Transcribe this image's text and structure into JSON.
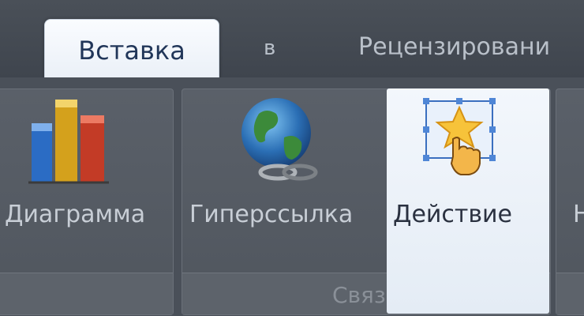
{
  "ribbon": {
    "tabs": [
      {
        "label": "Вставка",
        "active": true
      },
      {
        "label": "в",
        "active": false
      },
      {
        "label": "Рецензировани",
        "active": false
      }
    ]
  },
  "groups": {
    "charts": {
      "button_label": "Диаграмма"
    },
    "links": {
      "title": "Связи",
      "hyperlink_label": "Гиперссылка",
      "action_label": "Действие"
    },
    "next_fragment": "Н"
  },
  "colors": {
    "accent": "#213659",
    "highlight": "#eef3f9",
    "ribbon_dark": "#4a5059"
  },
  "icons": {
    "chart": "bar-chart-icon",
    "hyperlink": "globe-link-icon",
    "action": "star-pointer-icon"
  }
}
